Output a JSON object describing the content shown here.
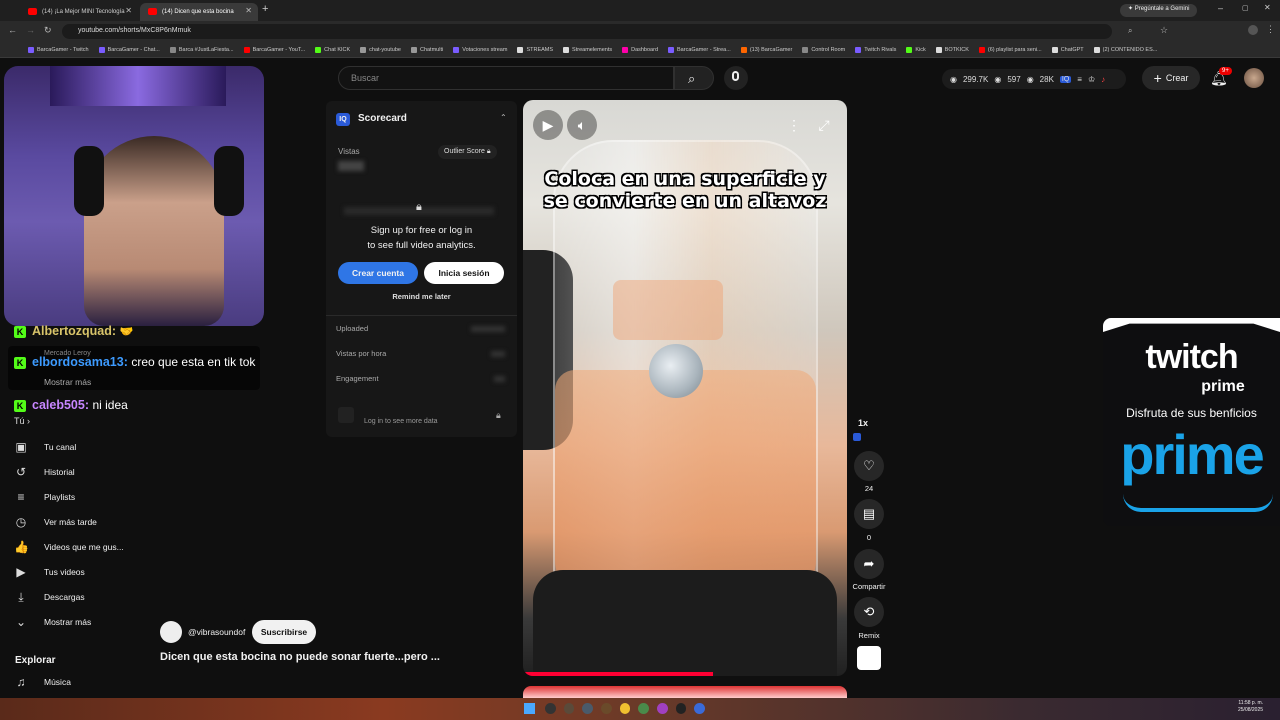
{
  "browser": {
    "tabs": [
      {
        "label": "(14) ¡La Mejor MINI Tecnología",
        "active": false
      },
      {
        "label": "(14) Dicen que esta bocina",
        "active": true
      }
    ],
    "gemini_label": "Pregúntale a Gemini",
    "url": "youtube.com/shorts/MxC8P6nMmuk",
    "bookmarks": [
      "BarcaGamer - Twitch",
      "BarcaGamer - Chat...",
      "Barca #JustLaFiesta...",
      "BarcaGamer - YouT...",
      "Chat KICK",
      "chat-youtube",
      "Chatmulti",
      "Votaciones stream",
      "STREAMS",
      "Streamelements",
      "Dashboard",
      "BarcaGamer - Strea...",
      "(13) BarcaGamer",
      "Control Room",
      "Twitch Rivals",
      "Kick",
      "BOTKICK",
      "(6) playlist para seni...",
      "ChatGPT",
      "(2) CONTENIDO ES..."
    ]
  },
  "chat": [
    {
      "user": "Albertozquad:",
      "text": "",
      "user_color": "#d8c46a"
    },
    {
      "user": "elbordosama13:",
      "text": "creo que esta en tik tok",
      "user_color": "#3d9bff"
    },
    {
      "user": "caleb505:",
      "text": "ni idea",
      "user_color": "#c786ff"
    }
  ],
  "sidebar": {
    "hidden_labels": [
      "Mercado Leroy",
      "Mostrar más",
      "Tú"
    ],
    "items": [
      {
        "label": "Tu canal",
        "icon": "person-box-icon"
      },
      {
        "label": "Historial",
        "icon": "history-icon"
      },
      {
        "label": "Playlists",
        "icon": "playlist-icon"
      },
      {
        "label": "Ver más tarde",
        "icon": "clock-icon"
      },
      {
        "label": "Videos que me gus...",
        "icon": "thumbs-up-icon"
      },
      {
        "label": "Tus videos",
        "icon": "video-icon"
      },
      {
        "label": "Descargas",
        "icon": "download-icon"
      },
      {
        "label": "Mostrar más",
        "icon": "chevron-down-icon"
      }
    ],
    "explore_title": "Explorar",
    "explore_items": [
      {
        "label": "Música",
        "icon": "music-icon"
      }
    ]
  },
  "header": {
    "search_placeholder": "Buscar",
    "stats": {
      "views": "299.7K",
      "viewers": "597",
      "followers": "28K"
    },
    "create_label": "Crear",
    "notif_badge": "9+"
  },
  "scorecard": {
    "title": "Scorecard",
    "views_label": "Vistas",
    "outlier_label": "Outlier Score",
    "signup_line1": "Sign up for free or log in",
    "signup_line2": "to see full video analytics.",
    "create_account": "Crear cuenta",
    "login": "Inicia sesión",
    "remind": "Remind me later",
    "rows": [
      "Uploaded",
      "Vistas por hora",
      "Engagement"
    ],
    "login_more": "Log in to see more data"
  },
  "video": {
    "caption": "Coloca en una superficie y se convierte en un altavoz",
    "channel": "@vibrasoundof",
    "subscribe": "Suscribirse",
    "title": "Dicen que esta bocina no puede sonar fuerte...pero ...",
    "speed": "1x",
    "likes": "24",
    "comments": "0",
    "share_label": "Compartir",
    "remix_label": "Remix"
  },
  "twitch_ad": {
    "brand": "twitch",
    "sub": "prime",
    "tagline": "Disfruta de sus benficios",
    "big": "prime",
    "brand_color": "#1aa3e8"
  },
  "taskbar": {
    "time": "11:58 p. m.",
    "date": "25/08/2025"
  }
}
